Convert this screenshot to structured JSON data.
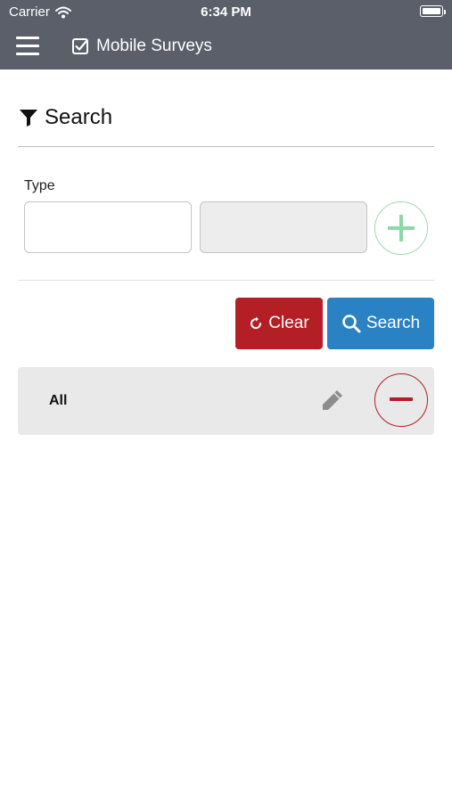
{
  "status_bar": {
    "carrier": "Carrier",
    "time": "6:34 PM"
  },
  "header": {
    "title": "Mobile Surveys",
    "menu_icon": "hamburger-icon",
    "title_icon": "checkbox-icon"
  },
  "search": {
    "heading": "Search",
    "heading_icon": "funnel-icon"
  },
  "type_field": {
    "label": "Type",
    "input_value": "",
    "secondary_value": ""
  },
  "actions": {
    "clear_label": "Clear",
    "search_label": "Search"
  },
  "results": [
    {
      "label": "All"
    }
  ],
  "colors": {
    "header": "#5a5f6a",
    "clear": "#b31f24",
    "search": "#2a82c4",
    "add": "#8ed7a8",
    "remove": "#b31f24",
    "row": "#e9e9e9"
  }
}
